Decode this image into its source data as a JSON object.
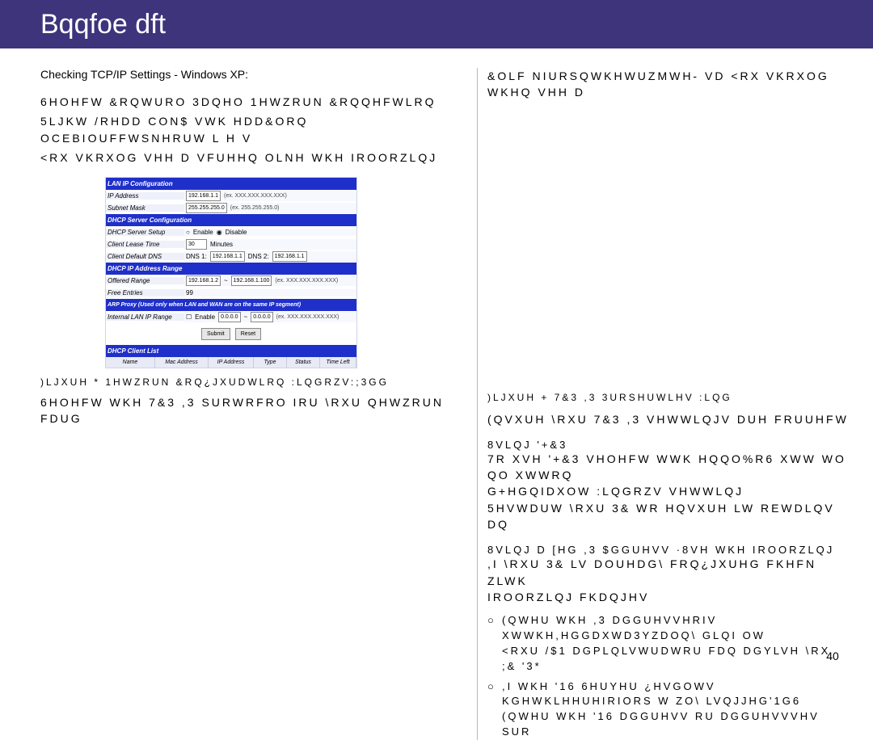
{
  "header": {
    "title": "Bqqfoe   dft"
  },
  "left": {
    "subtitle": "Checking TCP/IP Settings - Windows XP:",
    "bullets": [
      "6HOHFW &RQWURO 3DQHO   1HWZRUN &RQQHFWLRQ",
      "5LJKW /RHDD CON$ VWK HDD&ORQ OCEBIOUFFWSNHRUW L H V",
      "<RX VKRXOG VHH D VFUHHQ OLNH WKH IROORZLQJ"
    ],
    "fig": {
      "sec1": "LAN IP Configuration",
      "row_ip_addr_label": "IP Address",
      "row_ip_addr_val": "192.168.1.1",
      "row_ip_addr_hint": "(ex. XXX.XXX.XXX.XXX)",
      "row_subnet_label": "Subnet Mask",
      "row_subnet_val": "255.255.255.0",
      "row_subnet_hint": "(ex. 255.255.255.0)",
      "sec2": "DHCP Server Configuration",
      "row_dhcp_setup_label": "DHCP Server Setup",
      "row_dhcp_setup_enable": "Enable",
      "row_dhcp_setup_disable": "Disable",
      "row_lease_label": "Client Lease Time",
      "row_lease_val": "30",
      "row_lease_unit": "Minutes",
      "row_default_dns_label": "Client Default DNS",
      "row_dns1_label": "DNS 1:",
      "row_dns1_val": "192.168.1.1",
      "row_dns2_label": "DNS 2:",
      "row_dns2_val": "192.168.1.1",
      "sec3": "DHCP IP Address Range",
      "row_offered_label": "Offered Range",
      "row_offered_from": "192.168.1.2",
      "row_offered_to": "192.168.1.100",
      "row_offered_hint": "(ex. XXX.XXX.XXX.XXX)",
      "row_free_label": "Free Entries",
      "row_free_val": "99",
      "sec4": "ARP Proxy (Used only when LAN and WAN are on the same IP segment)",
      "row_internal_label": "Internal LAN IP Range",
      "row_internal_chk": "Enable",
      "row_internal_from": "0.0.0.0",
      "row_internal_to": "0.0.0.0",
      "row_internal_hint": "(ex. XXX.XXX.XXX.XXX)",
      "submit": "Submit",
      "reset": "Reset",
      "sec5": "DHCP Client List",
      "colh_name": "Name",
      "colh_mac": "Mac Address",
      "colh_ip": "IP Address",
      "colh_type": "Type",
      "colh_status": "Status",
      "colh_time": "Time Left"
    },
    "caption": ")LJXUH *  1HWZRUN &RQ¿JXUDWLRQ   :LQGRZV:;3GG",
    "bottom": "6HOHFW WKH 7&3 ,3 SURWRFRO IRU \\RXU QHWZRUN FDUG"
  },
  "right": {
    "top": "&OLF NIURSQWKHWUZMWH- VD   <RX VKRXOG WKHQ VHH D",
    "caption": ")LJXUH +  7&3 ,3 3URSHUWLHV  :LQG",
    "line1": "(QVXUH \\RXU 7&3 ,3 VHWWLQJV DUH FRUUHFW",
    "sub1": "8VLQJ '+&3",
    "para1_a": "7R XVH '+&3  VHOHFW WWK HQQO%R6 XWW WO QO XWWRQ",
    "para1_b": "G+HGQIDXOW :LQGRZV VHWWLQJ",
    "para1_c": "5HVWDUW \\RXU 3& WR HQVXUH LW REWDLQV DQ",
    "sub2": "8VLQJ D  [HG ,3 $GGUHVV  ·8VH WKH IROORZLQJ",
    "para2_a": ",I \\RXU 3& LV DOUHDG\\ FRQ¿JXUHG  FKHFN ZLWK",
    "para2_b": "IROORZLQJ FKDQJHV",
    "obul1_a": "(QWHU WKH ,3 DGGUHVVHRIV XWWKH,HGGDXWD3YZDOQ\\ GLQI OW",
    "obul1_b": "<RXU /$1 DGPLQLVWUDWRU FDQ DGYLVH \\RX",
    "obul1_c": ";& '3*",
    "obul2_a": ",I WKH '16 6HUYHU ¿HVGOWV KGHWKLHHUHIRIORS W ZO\\ LVQJJHG'1G6",
    "obul2_b": "(QWHU WKH '16 DGGUHVV RU DGGUHVVVHV SUR"
  },
  "page_number": "40"
}
